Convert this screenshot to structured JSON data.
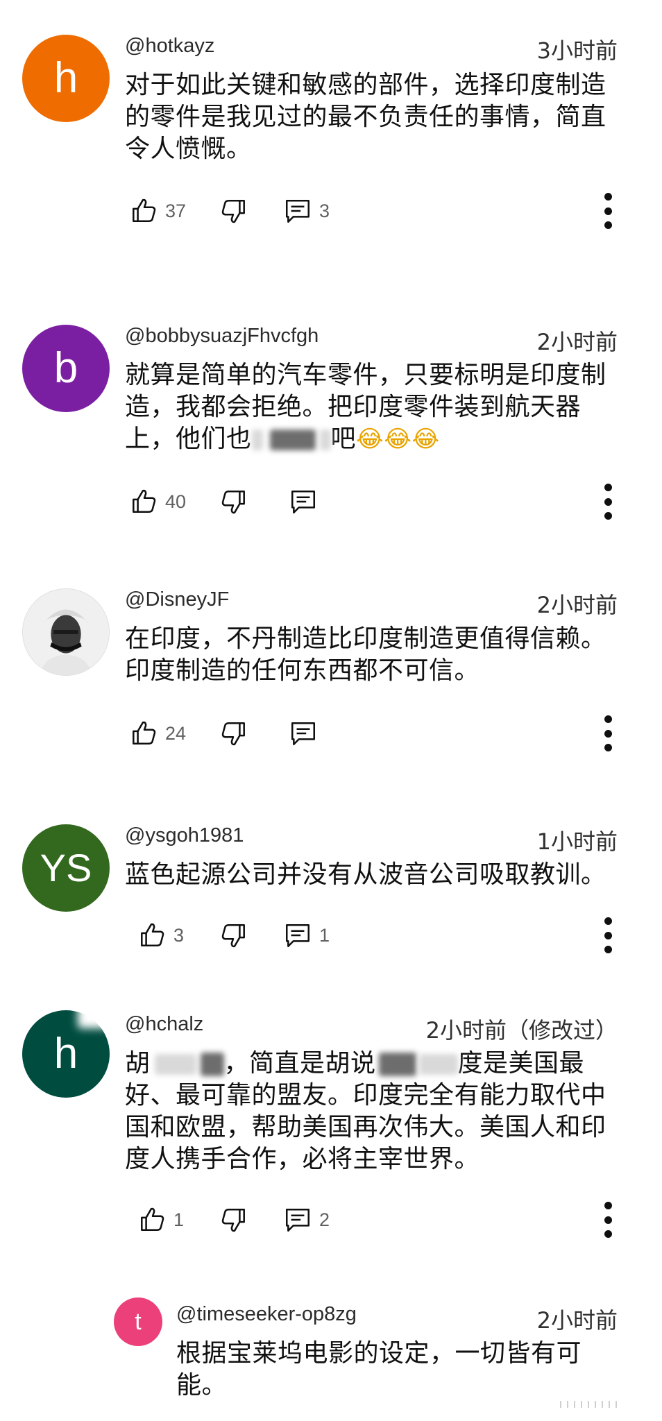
{
  "comments": [
    {
      "handle": "@hotkayz",
      "time": "3小时前",
      "avatar_letter": "h",
      "avatar_color": "#ef6c00",
      "text": "对于如此关键和敏感的部件，选择印度制造的零件是我见过的最不负责任的事情，简直令人愤慨。",
      "likes": "37",
      "replies": "3"
    },
    {
      "handle": "@bobbysuazjFhvcfgh",
      "time": "2小时前",
      "avatar_letter": "b",
      "avatar_color": "#7b1fa2",
      "text_a": "就算是简单的汽车零件，只要标明是印度制造，我都会拒绝。把印度零件装到航天器上，他们也",
      "text_b": "吧",
      "emoji": "😂😂😂",
      "likes": "40"
    },
    {
      "handle": "@DisneyJF",
      "time": "2小时前",
      "text": "在印度，不丹制造比印度制造更值得信赖。印度制造的任何东西都不可信。",
      "likes": "24"
    },
    {
      "handle": "@ysgoh1981",
      "time": "1小时前",
      "avatar_letter": "YS",
      "avatar_color": "#33691e",
      "text": "蓝色起源公司并没有从波音公司吸取教训。",
      "likes": "3",
      "replies": "1"
    },
    {
      "handle": "@hchalz",
      "time": "2小时前（修改过）",
      "avatar_letter": "h",
      "avatar_color": "#004d40",
      "text_a": "胡",
      "text_b": "，简直是胡说",
      "text_c": "度是美国最好、最可靠的盟友。印度完全有能力取代中国和欧盟，帮助美国再次伟大。美国人和印度人携手合作，必将主宰世界。",
      "likes": "1",
      "replies": "2"
    },
    {
      "handle": "@timeseeker-op8zg",
      "time": "2小时前",
      "avatar_letter": "t",
      "avatar_color": "#ec407a",
      "text": "根据宝莱坞电影的设定，一切皆有可能。"
    }
  ],
  "icons": {
    "like": "thumbs-up-icon",
    "dislike": "thumbs-down-icon",
    "reply": "reply-comment-icon",
    "more": "more-vertical-icon"
  }
}
